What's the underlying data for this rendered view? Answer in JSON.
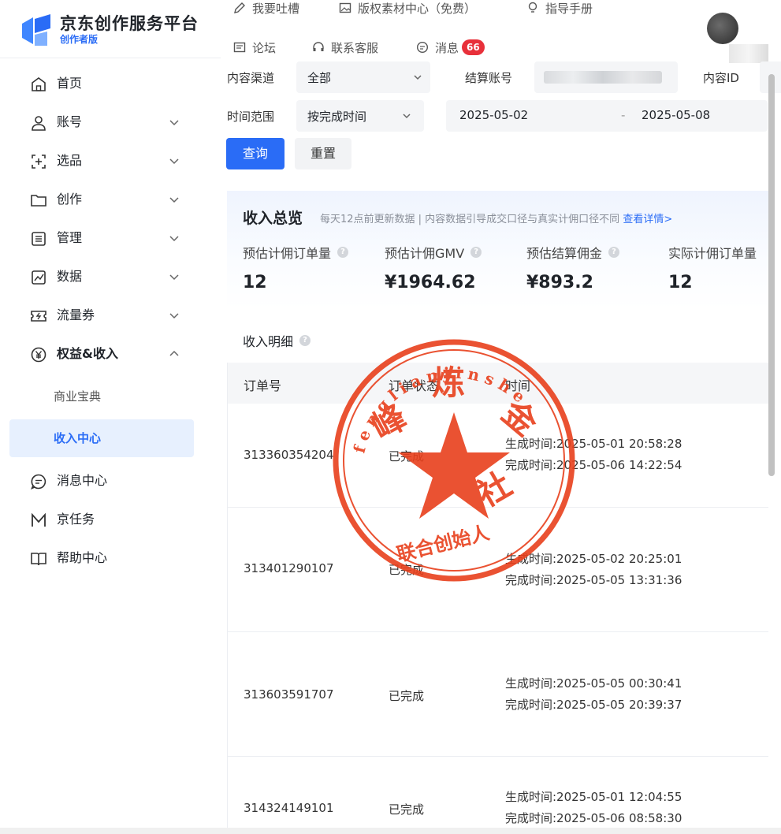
{
  "brand": {
    "title": "京东创作服务平台",
    "subtitle": "创作者版"
  },
  "topnav": {
    "feedback": "我要吐槽",
    "copyright": "版权素材中心（免费）",
    "guide": "指导手册",
    "forum": "论坛",
    "support": "联系客服",
    "messages": "消息",
    "messages_count": "66"
  },
  "sidebar": {
    "items": [
      {
        "label": "首页",
        "icon": "home-icon"
      },
      {
        "label": "账号",
        "icon": "user-icon"
      },
      {
        "label": "选品",
        "icon": "add-product-icon"
      },
      {
        "label": "创作",
        "icon": "folder-icon"
      },
      {
        "label": "管理",
        "icon": "list-icon"
      },
      {
        "label": "数据",
        "icon": "chart-icon"
      },
      {
        "label": "流量券",
        "icon": "ticket-icon"
      },
      {
        "label": "权益&收入",
        "icon": "yen-icon"
      },
      {
        "label": "消息中心",
        "icon": "message-icon"
      },
      {
        "label": "京任务",
        "icon": "task-icon"
      },
      {
        "label": "帮助中心",
        "icon": "book-icon"
      }
    ],
    "sub_items": [
      {
        "label": "商业宝典"
      },
      {
        "label": "收入中心"
      }
    ]
  },
  "filters": {
    "channel_label": "内容渠道",
    "channel_value": "全部",
    "account_label": "结算账号",
    "content_id_label": "内容ID",
    "time_label": "时间范围",
    "time_type": "按完成时间",
    "date_start": "2025-05-02",
    "date_sep": "-",
    "date_end": "2025-05-08",
    "query_button": "查询",
    "reset_button": "重置"
  },
  "summary": {
    "title": "收入总览",
    "note": "每天12点前更新数据 | 内容数据引导成交口径与真实计佣口径不同",
    "link": "查看详情>",
    "stats": [
      {
        "label": "预估计佣订单量",
        "value": "12"
      },
      {
        "label": "预估计佣GMV",
        "value": "¥1964.62"
      },
      {
        "label": "预估结算佣金",
        "value": "¥893.2"
      },
      {
        "label": "实际计佣订单量",
        "value": "12"
      }
    ]
  },
  "detail": {
    "title": "收入明细",
    "columns": [
      "订单号",
      "订单状态",
      "时间"
    ],
    "rows": [
      {
        "order_id": "313360354204",
        "status": "已完成",
        "created": "生成时间:2025-05-01 20:58:28",
        "completed": "完成时间:2025-05-06 14:22:54"
      },
      {
        "order_id": "313401290107",
        "status": "已完成",
        "created": "生成时间:2025-05-02 20:25:01",
        "completed": "完成时间:2025-05-05 13:31:36"
      },
      {
        "order_id": "313603591707",
        "status": "已完成",
        "created": "生成时间:2025-05-05 00:30:41",
        "completed": "完成时间:2025-05-05 20:39:37"
      },
      {
        "order_id": "314324149101",
        "status": "已完成",
        "created": "生成时间:2025-05-01 12:04:55",
        "completed": "完成时间:2025-05-06 08:58:30"
      }
    ]
  },
  "seal": {
    "text_top": "fenglianjinshe",
    "chars": [
      "峰",
      "炼",
      "金",
      "社",
      "联合创始人"
    ],
    "color": "#e8401c"
  },
  "colors": {
    "accent": "#2a6cf6",
    "badge": "#e8303a"
  }
}
